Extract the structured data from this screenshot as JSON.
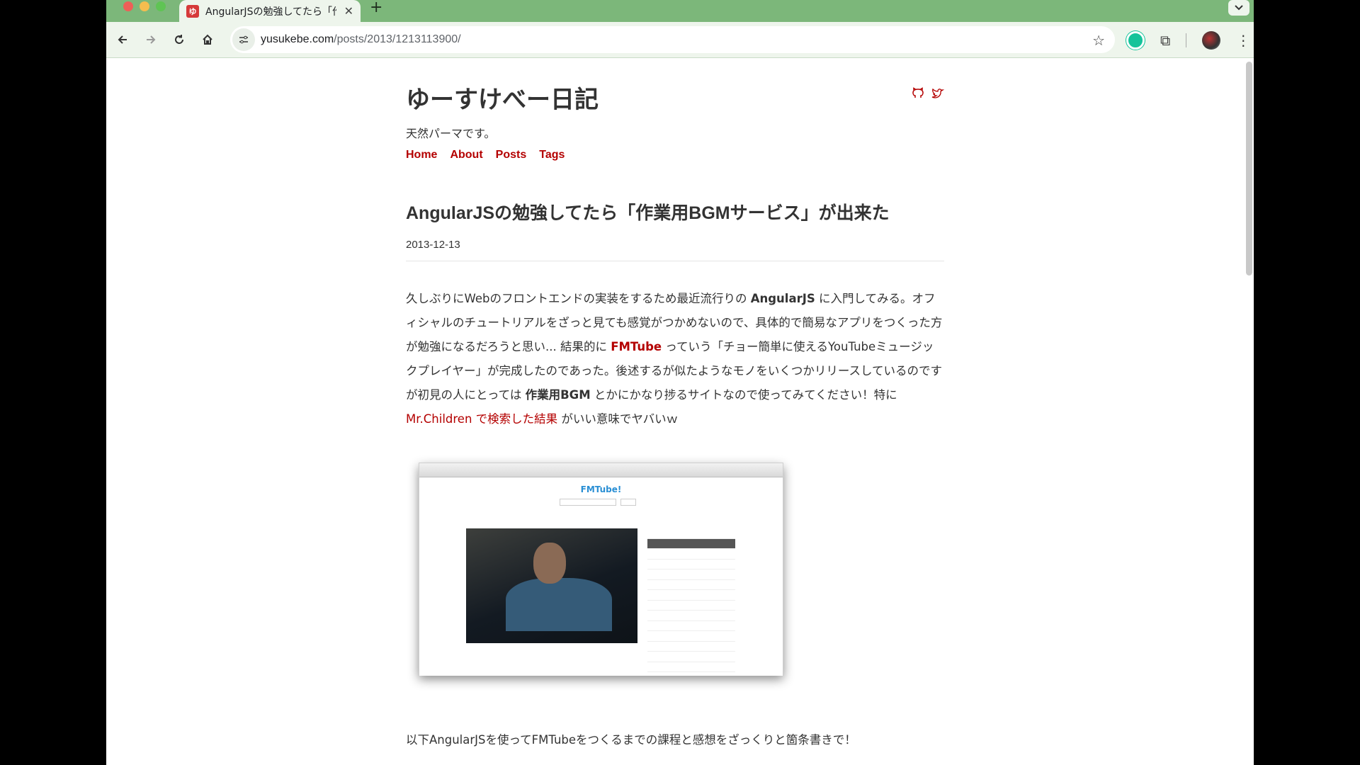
{
  "browser": {
    "tab": {
      "favicon_text": "ゆ",
      "title": "AngularJSの勉強してたら「作業",
      "close": "✕"
    },
    "new_tab": "+",
    "tab_list": "⌄",
    "nav": {
      "back": "←",
      "forward": "→",
      "reload": "↻",
      "home": "⌂"
    },
    "url": {
      "host": "yusukebe.com",
      "path": "/posts/2013/1213113900/"
    },
    "bookmark": "☆",
    "extensions": "⧉",
    "menu": "⋮"
  },
  "site": {
    "title": "ゆーすけべー日記",
    "tagline": "天然パーマです。",
    "nav": [
      "Home",
      "About",
      "Posts",
      "Tags"
    ],
    "social": [
      "github-icon",
      "twitter-icon"
    ]
  },
  "post": {
    "title": "AngularJSの勉強してたら「作業用BGMサービス」が出来た",
    "date": "2013-12-13",
    "p1": {
      "a": "久しぶりにWebのフロントエンドの実装をするため最近流行りの ",
      "b": "AngularJS",
      "c": " に入門してみる。オフィシャルのチュートリアルをざっと見ても感覚がつかめないので、具体的で簡易なアプリをつくった方が勉強になるだろうと思い... 結果的に ",
      "d": "FMTube",
      "e": " っていう「チョー簡単に使えるYouTubeミュージックプレイヤー」が完成したのであった。後述するが似たようなモノをいくつかリリースしているのですが初見の人にとっては ",
      "f": "作業用BGM",
      "g": " とかにかなり捗るサイトなので使ってみてください！特に ",
      "h": "Mr.Children で検索した結果",
      "i": " がいい意味でヤバいｗ"
    },
    "screenshot_title": "FMTube!",
    "outro": "以下AngularJSを使ってFMTubeをつくるまでの課程と感想をざっくりと箇条書きで！"
  },
  "colors": {
    "accent": "#b40000",
    "chrome": "#7cb77a",
    "toolbar": "#eef5ec"
  }
}
